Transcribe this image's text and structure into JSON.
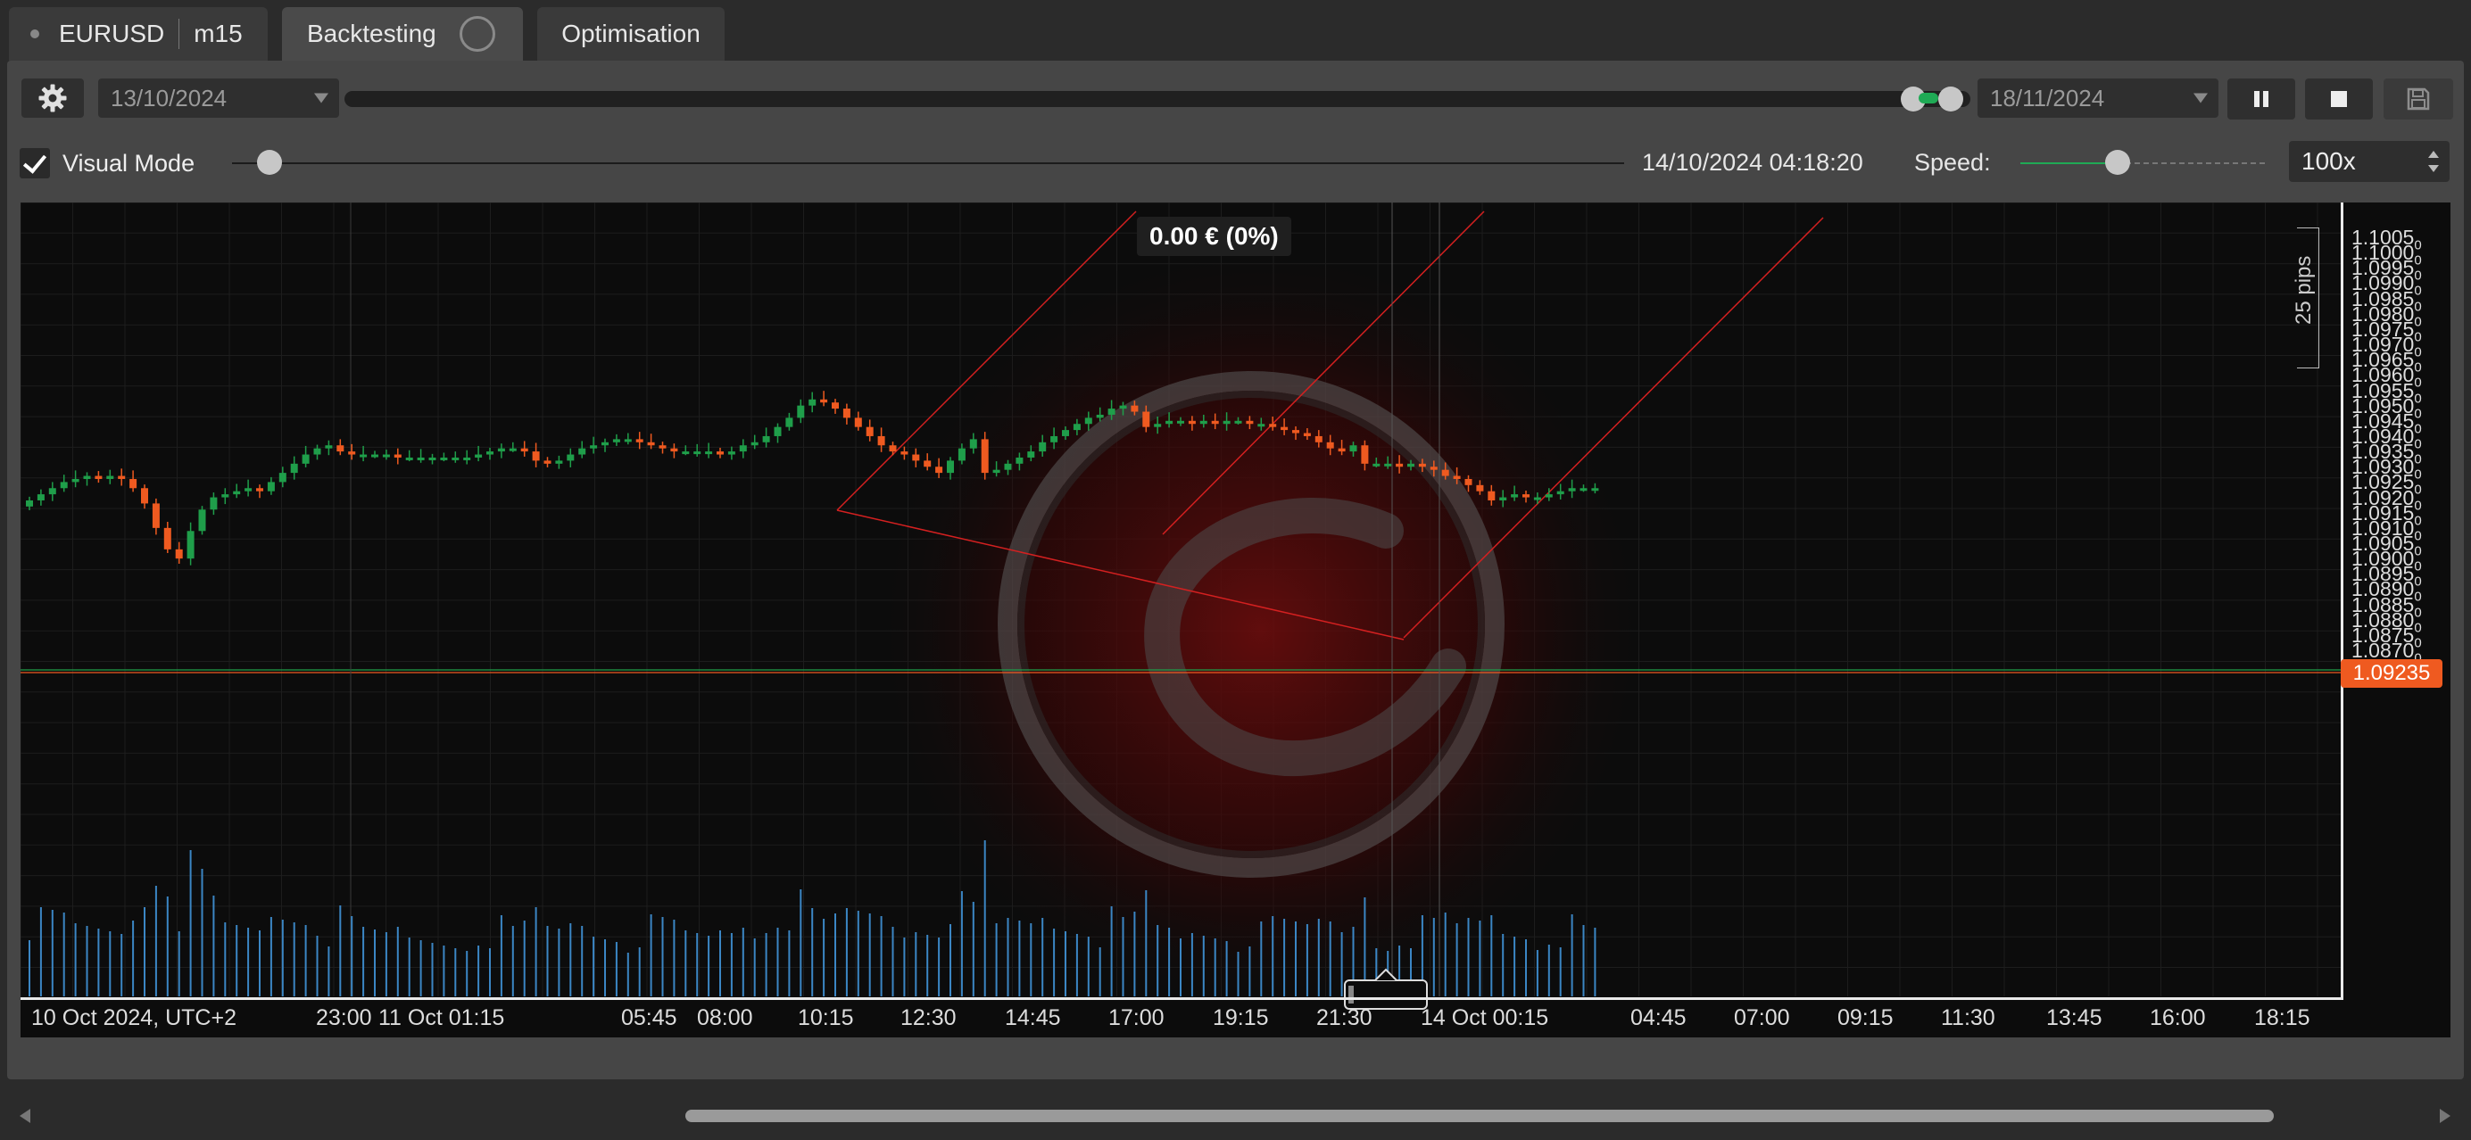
{
  "tabs": {
    "symbol": "EURUSD",
    "timeframe": "m15",
    "backtesting": "Backtesting",
    "optimisation": "Optimisation"
  },
  "toolbar": {
    "start_date": "13/10/2024",
    "end_date": "18/11/2024",
    "visual_mode_label": "Visual Mode",
    "visual_mode_checked": true,
    "current_time": "14/10/2024 04:18:20",
    "speed_label": "Speed:",
    "speed_value": "100x"
  },
  "chart": {
    "pnl_label": "0.00 € (0%)",
    "pips_label": "25 pips",
    "current_price": "1.09235",
    "x_ticks": [
      "10 Oct 2024, UTC+2",
      "23:00",
      "11 Oct 01:15",
      "05:45",
      "08:00",
      "10:15",
      "12:30",
      "14:45",
      "17:00",
      "19:15",
      "21:30",
      "14 Oct 00:15",
      "04:45",
      "07:00",
      "09:15",
      "11:30",
      "13:45",
      "16:00",
      "18:15"
    ],
    "y_ticks": [
      "1.1005",
      "1.1000",
      "1.0995",
      "1.0990",
      "1.0985",
      "1.0980",
      "1.0975",
      "1.0970",
      "1.0965",
      "1.0960",
      "1.0955",
      "1.0950",
      "1.0945",
      "1.0940",
      "1.0935",
      "1.0930",
      "1.0925",
      "1.0920",
      "1.0915",
      "1.0910",
      "1.0905",
      "1.0900",
      "1.0895",
      "1.0890",
      "1.0885",
      "1.0880",
      "1.0875",
      "1.0870"
    ],
    "y_tick_suffix": "0",
    "colors": {
      "up": "#1f9e4a",
      "down": "#ef5a20",
      "volume": "#3b86c4",
      "drawing": "#d42020"
    }
  },
  "chart_data": {
    "type": "candlestick",
    "symbol": "EURUSD",
    "timeframe": "m15",
    "ylim": [
      1.08675,
      1.1008
    ],
    "close": [
      1.0919,
      1.0921,
      1.0923,
      1.0925,
      1.0926,
      1.0927,
      1.0926,
      1.0927,
      1.0926,
      1.0923,
      1.0918,
      1.091,
      1.0903,
      1.09,
      1.0909,
      1.0916,
      1.092,
      1.0921,
      1.0922,
      1.0923,
      1.0922,
      1.0925,
      1.0928,
      1.0931,
      1.0934,
      1.0936,
      1.0937,
      1.0935,
      1.0934,
      1.0934,
      1.0934,
      1.0934,
      1.0933,
      1.0933,
      1.0933,
      1.0933,
      1.0933,
      1.0933,
      1.0933,
      1.0934,
      1.0935,
      1.0936,
      1.0936,
      1.0935,
      1.0932,
      1.0931,
      1.0932,
      1.0934,
      1.0936,
      1.0937,
      1.0938,
      1.0939,
      1.0939,
      1.0938,
      1.0937,
      1.0936,
      1.0935,
      1.0935,
      1.0935,
      1.0935,
      1.0934,
      1.0935,
      1.0937,
      1.0938,
      1.094,
      1.0943,
      1.0946,
      1.095,
      1.0952,
      1.0951,
      1.0949,
      1.0946,
      1.0943,
      1.094,
      1.0937,
      1.0935,
      1.0934,
      1.0932,
      1.093,
      1.0928,
      1.0932,
      1.0936,
      1.0939,
      1.0928,
      1.0929,
      1.0931,
      1.0933,
      1.0935,
      1.0938,
      1.094,
      1.0942,
      1.0944,
      1.0946,
      1.0947,
      1.0949,
      1.095,
      1.0948,
      1.0943,
      1.0944,
      1.0945,
      1.0945,
      1.0944,
      1.0945,
      1.0944,
      1.0945,
      1.0945,
      1.0944,
      1.0944,
      1.0943,
      1.0942,
      1.0941,
      1.094,
      1.0938,
      1.0936,
      1.0935,
      1.0937,
      1.0931,
      1.0931,
      1.0931,
      1.093,
      1.0931,
      1.093,
      1.0929,
      1.0927,
      1.0926,
      1.0924,
      1.0922,
      1.0919,
      1.092,
      1.0921,
      1.092,
      1.092,
      1.0921,
      1.0922,
      1.0923,
      1.0923,
      1.0923
    ]
  }
}
